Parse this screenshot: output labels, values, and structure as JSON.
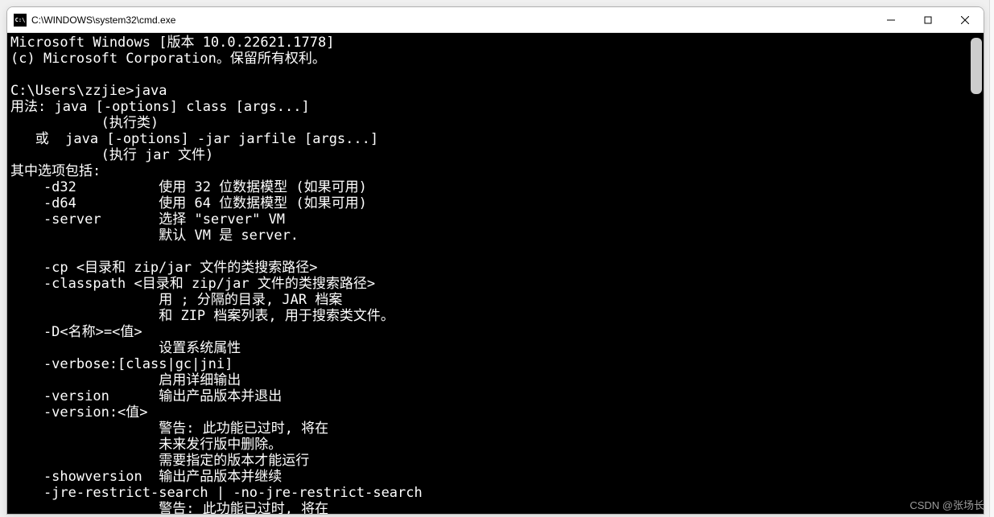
{
  "titlebar": {
    "icon_text": "C:\\",
    "title": "C:\\WINDOWS\\system32\\cmd.exe"
  },
  "terminal": {
    "lines": [
      "Microsoft Windows [版本 10.0.22621.1778]",
      "(c) Microsoft Corporation。保留所有权利。",
      "",
      "C:\\Users\\zzjie>java",
      "用法: java [-options] class [args...]",
      "           (执行类)",
      "   或  java [-options] -jar jarfile [args...]",
      "           (执行 jar 文件)",
      "其中选项包括:",
      "    -d32          使用 32 位数据模型 (如果可用)",
      "    -d64          使用 64 位数据模型 (如果可用)",
      "    -server       选择 \"server\" VM",
      "                  默认 VM 是 server.",
      "",
      "    -cp <目录和 zip/jar 文件的类搜索路径>",
      "    -classpath <目录和 zip/jar 文件的类搜索路径>",
      "                  用 ; 分隔的目录, JAR 档案",
      "                  和 ZIP 档案列表, 用于搜索类文件。",
      "    -D<名称>=<值>",
      "                  设置系统属性",
      "    -verbose:[class|gc|jni]",
      "                  启用详细输出",
      "    -version      输出产品版本并退出",
      "    -version:<值>",
      "                  警告: 此功能已过时, 将在",
      "                  未来发行版中删除。",
      "                  需要指定的版本才能运行",
      "    -showversion  输出产品版本并继续",
      "    -jre-restrict-search | -no-jre-restrict-search",
      "                  警告: 此功能已过时, 将在"
    ]
  },
  "watermark": "CSDN @张场长"
}
